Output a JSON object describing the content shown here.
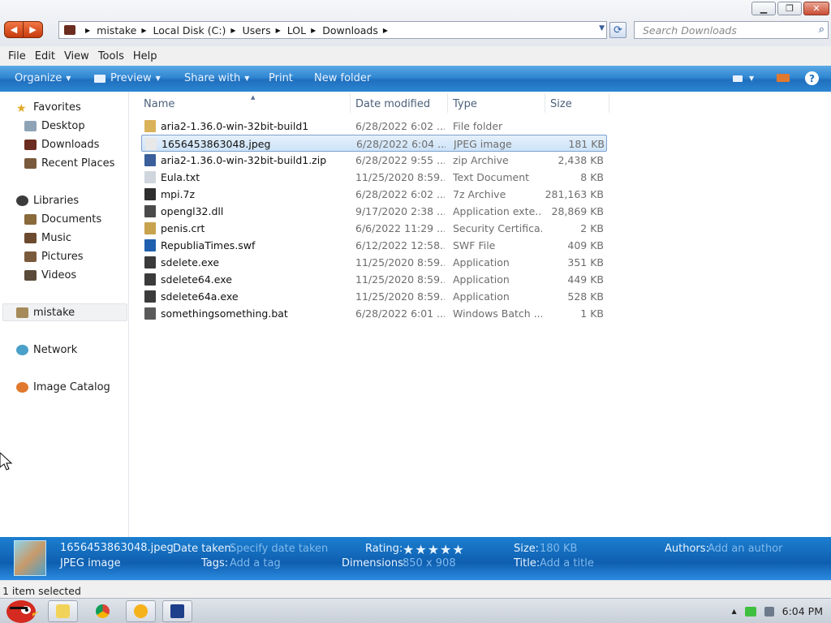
{
  "window": {
    "minimize": "▁",
    "maximize": "❐",
    "close": "✕"
  },
  "nav": {
    "back": "◀",
    "forward": "▶"
  },
  "address": {
    "crumbs": [
      "mistake",
      "Local Disk (C:)",
      "Users",
      "LOL",
      "Downloads"
    ],
    "separator": "▶",
    "dropdown": "▼",
    "refresh": "⟳"
  },
  "search": {
    "placeholder": "Search Downloads",
    "icon": "⌕"
  },
  "menubar": [
    "File",
    "Edit",
    "View",
    "Tools",
    "Help"
  ],
  "toolbar": {
    "organize": "Organize",
    "preview": "Preview",
    "share_with": "Share with",
    "print": "Print",
    "new_folder": "New folder",
    "caret": "▼",
    "help": "?"
  },
  "navpane": {
    "favorites": "Favorites",
    "desktop": "Desktop",
    "downloads": "Downloads",
    "recent_places": "Recent Places",
    "libraries": "Libraries",
    "documents": "Documents",
    "music": "Music",
    "pictures": "Pictures",
    "videos": "Videos",
    "homegroup": "mistake",
    "network": "Network",
    "image_catalog": "Image Catalog"
  },
  "columns": {
    "name": "Name",
    "date_modified": "Date modified",
    "type": "Type",
    "size": "Size",
    "sort_arrow": "▲"
  },
  "files": [
    {
      "name": "aria2-1.36.0-win-32bit-build1",
      "date": "6/28/2022 6:02 ...",
      "type": "File folder",
      "size": "",
      "icon_color": "#d9b25a"
    },
    {
      "name": "1656453863048.jpeg",
      "date": "6/28/2022 6:04 ...",
      "type": "JPEG image",
      "size": "181 KB",
      "icon_color": "#e8e8e8"
    },
    {
      "name": "aria2-1.36.0-win-32bit-build1.zip",
      "date": "6/28/2022 9:55 ...",
      "type": "zip Archive",
      "size": "2,438 KB",
      "icon_color": "#3a5f9a"
    },
    {
      "name": "Eula.txt",
      "date": "11/25/2020 8:59...",
      "type": "Text Document",
      "size": "8 KB",
      "icon_color": "#cfd6dd"
    },
    {
      "name": "mpi.7z",
      "date": "6/28/2022 6:02 ...",
      "type": "7z Archive",
      "size": "281,163 KB",
      "icon_color": "#2e2e2e"
    },
    {
      "name": "opengl32.dll",
      "date": "9/17/2020 2:38 ...",
      "type": "Application exte...",
      "size": "28,869 KB",
      "icon_color": "#4a4a4a"
    },
    {
      "name": "penis.crt",
      "date": "6/6/2022 11:29 ...",
      "type": "Security Certifica...",
      "size": "2 KB",
      "icon_color": "#c9a24e"
    },
    {
      "name": "RepubliaTimes.swf",
      "date": "6/12/2022 12:58...",
      "type": "SWF File",
      "size": "409 KB",
      "icon_color": "#1f5fae"
    },
    {
      "name": "sdelete.exe",
      "date": "11/25/2020 8:59...",
      "type": "Application",
      "size": "351 KB",
      "icon_color": "#3b3b3b"
    },
    {
      "name": "sdelete64.exe",
      "date": "11/25/2020 8:59...",
      "type": "Application",
      "size": "449 KB",
      "icon_color": "#3b3b3b"
    },
    {
      "name": "sdelete64a.exe",
      "date": "11/25/2020 8:59...",
      "type": "Application",
      "size": "528 KB",
      "icon_color": "#3b3b3b"
    },
    {
      "name": "somethingsomething.bat",
      "date": "6/28/2022 6:01 ...",
      "type": "Windows Batch ...",
      "size": "1 KB",
      "icon_color": "#5a5a5a"
    }
  ],
  "selected_index": 1,
  "details": {
    "filename": "1656453863048.jpeg",
    "filetype": "JPEG image",
    "date_taken_label": "Date taken:",
    "date_taken_value": "Specify date taken",
    "tags_label": "Tags:",
    "tags_value": "Add a tag",
    "rating_label": "Rating:",
    "rating_stars": "★★★★★",
    "dimensions_label": "Dimensions:",
    "dimensions_value": "850 x 908",
    "size_label": "Size:",
    "size_value": "180 KB",
    "title_label": "Title:",
    "title_value": "Add a title",
    "authors_label": "Authors:",
    "authors_value": "Add an author"
  },
  "status": {
    "text": "1 item selected"
  },
  "tray": {
    "clock": "6:04 PM"
  },
  "colors": {
    "toolbar_blue": "#2f86d1",
    "selection": "#cde3f8",
    "details_blue": "#0f5fb0"
  }
}
